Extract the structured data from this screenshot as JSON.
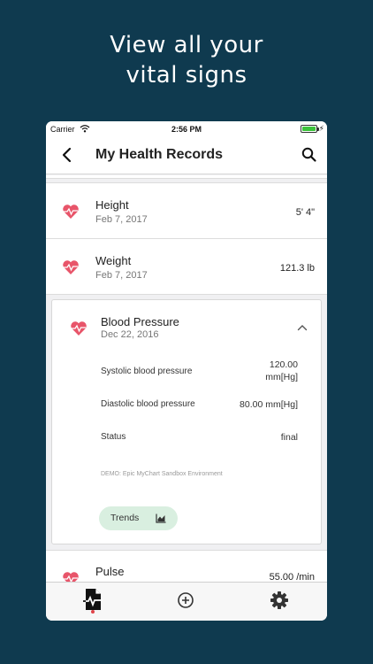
{
  "promo": {
    "line1": "View all your",
    "line2": "vital signs"
  },
  "status_bar": {
    "carrier": "Carrier",
    "time": "2:56 PM"
  },
  "navbar": {
    "title": "My Health Records"
  },
  "records": [
    {
      "name": "Height",
      "date": "Feb 7, 2017",
      "value": "5' 4\""
    },
    {
      "name": "Weight",
      "date": "Feb 7, 2017",
      "value": "121.3 lb"
    }
  ],
  "expanded_record": {
    "name": "Blood Pressure",
    "date": "Dec 22, 2016",
    "details": [
      {
        "label": "Systolic blood pressure",
        "value_line1": "120.00",
        "value_line2": "mm[Hg]"
      },
      {
        "label": "Diastolic blood pressure",
        "value": "80.00 mm[Hg]"
      },
      {
        "label": "Status",
        "value": "final"
      }
    ],
    "source": "DEMO: Epic MyChart Sandbox Environment",
    "trends_label": "Trends"
  },
  "partial_record": {
    "name": "Pulse",
    "value": "55.00 /min"
  },
  "icons": {
    "back": "chevron-left-icon",
    "search": "search-icon",
    "record": "heart-pulse-icon",
    "collapse": "chevron-up-icon",
    "trends": "chart-icon",
    "tab_records": "document-pulse-icon",
    "tab_add": "add-circle-icon",
    "tab_settings": "gear-icon"
  },
  "colors": {
    "background": "#0f3a4f",
    "heart": "#e8556a",
    "trends_bg": "#d9efe0",
    "active_dot": "#e0444a",
    "battery": "#3cc43c"
  }
}
